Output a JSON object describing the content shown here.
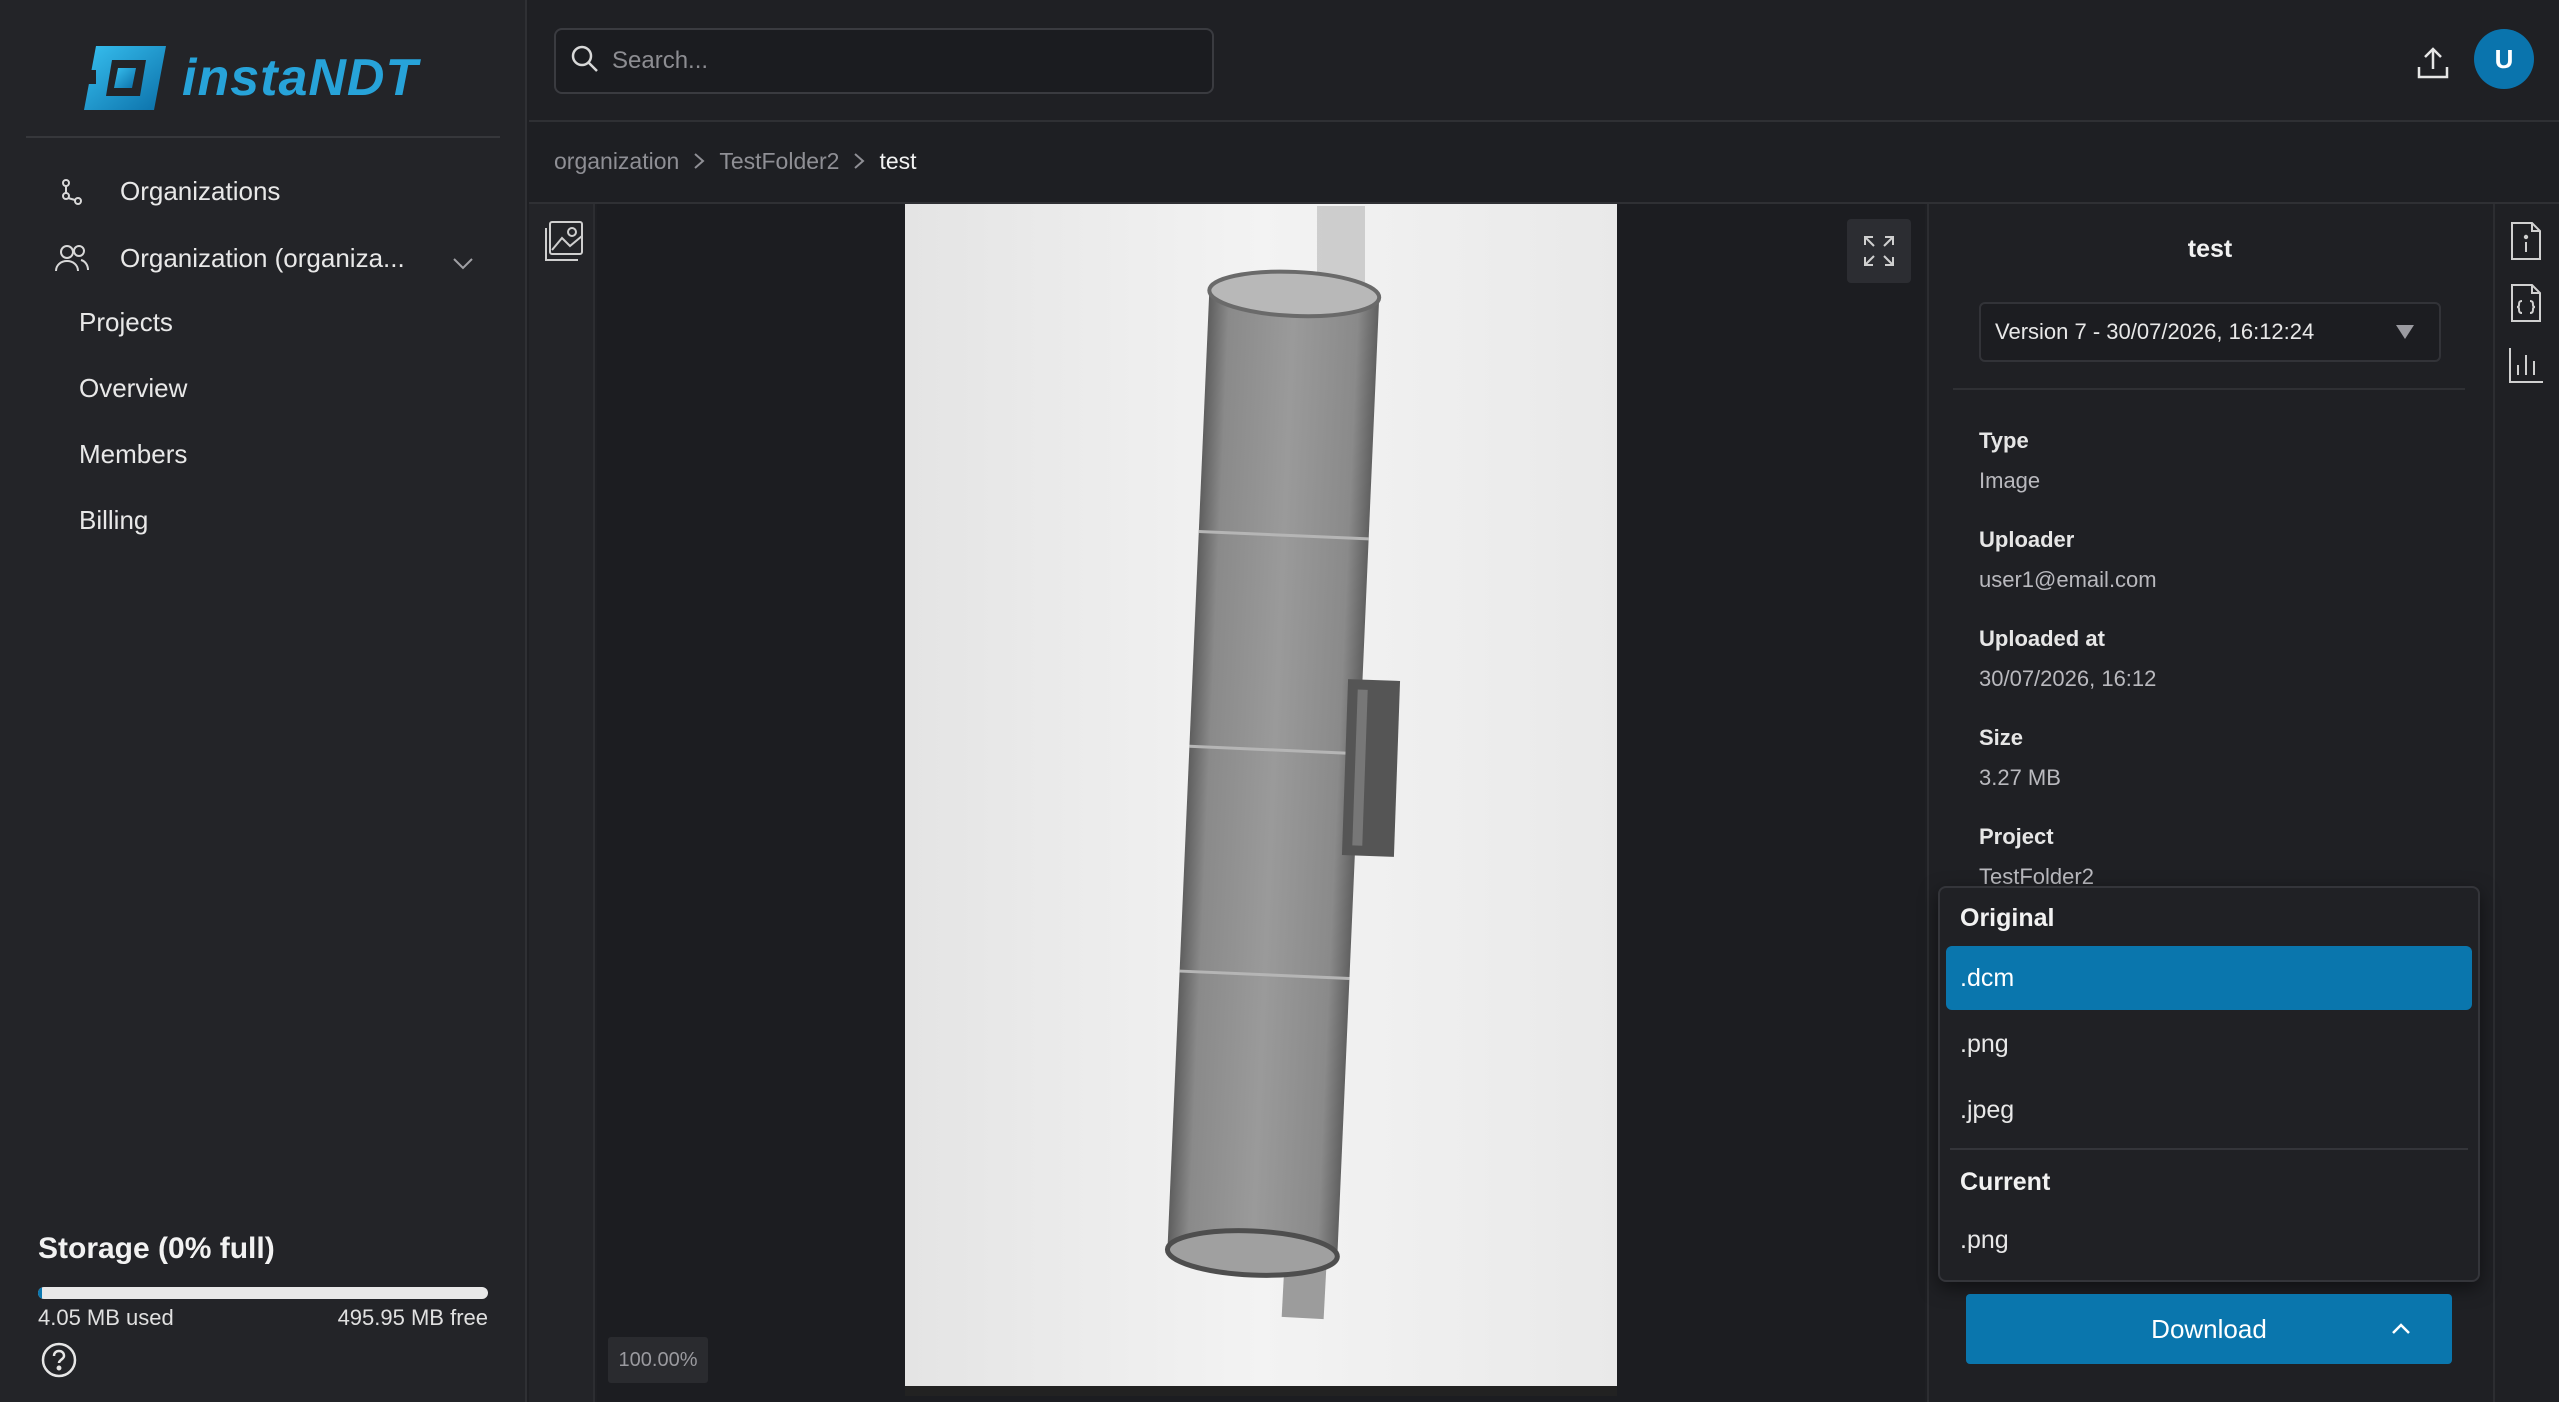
{
  "brand": {
    "name": "instaNDT",
    "accent": "#27a3d9"
  },
  "sidebar": {
    "items": [
      {
        "label": "Organizations",
        "icon": "organizations-icon"
      },
      {
        "label": "Organization (organiza...",
        "icon": "users-icon",
        "expanded": true
      }
    ],
    "subitems": [
      {
        "label": "Projects"
      },
      {
        "label": "Overview"
      },
      {
        "label": "Members"
      },
      {
        "label": "Billing"
      }
    ],
    "storage": {
      "title": "Storage (0% full)",
      "used": "4.05 MB used",
      "free": "495.95 MB free",
      "fraction_used": 0.008
    }
  },
  "topbar": {
    "search_placeholder": "Search...",
    "avatar_initial": "U"
  },
  "breadcrumb": {
    "items": [
      "organization",
      "TestFolder2"
    ],
    "current": "test"
  },
  "viewer": {
    "zoom": "100.00%"
  },
  "info": {
    "title": "test",
    "version": "Version 7 - 30/07/2026, 16:12:24",
    "properties": [
      {
        "label": "Type",
        "value": "Image"
      },
      {
        "label": "Uploader",
        "value": "user1@email.com"
      },
      {
        "label": "Uploaded at",
        "value": "30/07/2026, 16:12"
      },
      {
        "label": "Size",
        "value": "3.27 MB"
      },
      {
        "label": "Project",
        "value": "TestFolder2"
      }
    ]
  },
  "download_menu": {
    "original_label": "Original",
    "original_options": [
      ".dcm",
      ".png",
      ".jpeg"
    ],
    "selected": ".dcm",
    "current_label": "Current",
    "current_options": [
      ".png"
    ],
    "button_label": "Download"
  },
  "colors": {
    "primary": "#0a76ad",
    "background": "#1e1f23",
    "sidebar": "#232428"
  }
}
